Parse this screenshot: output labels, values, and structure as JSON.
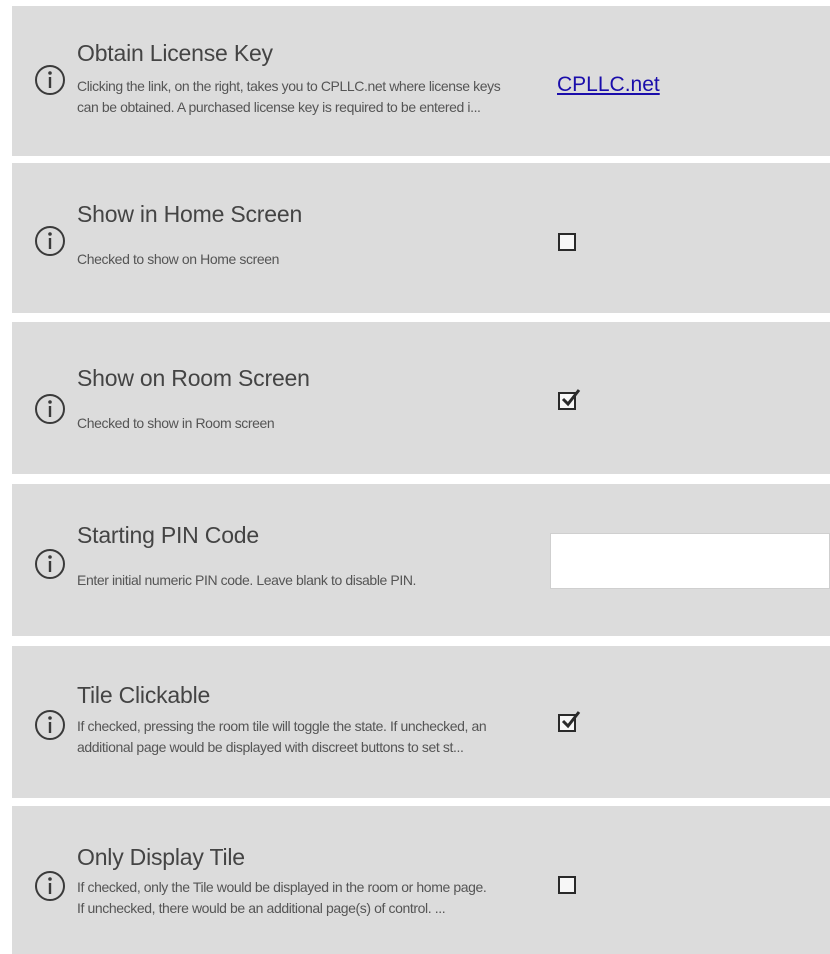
{
  "settings": [
    {
      "title": "Obtain License Key",
      "description_lines": [
        "Clicking the link, on the right, takes you to CPLLC.net where license keys",
        "can be obtained.  A purchased license key is required to be entered i..."
      ],
      "control": "link",
      "link_text": "CPLLC.net"
    },
    {
      "title": "Show in Home Screen",
      "description_lines": [
        "Checked to show on Home screen"
      ],
      "control": "checkbox",
      "checked": false
    },
    {
      "title": "Show on Room Screen",
      "description_lines": [
        "Checked to show in Room screen"
      ],
      "control": "checkbox",
      "checked": true
    },
    {
      "title": "Starting PIN Code",
      "description_lines": [
        "Enter initial numeric PIN code.  Leave blank to disable PIN."
      ],
      "control": "text-input",
      "value": ""
    },
    {
      "title": "Tile Clickable",
      "description_lines": [
        "If checked, pressing the room tile will toggle the state.  If unchecked, an",
        "additional page would  be displayed with discreet buttons to set st..."
      ],
      "control": "checkbox",
      "checked": true
    },
    {
      "title": "Only Display Tile",
      "description_lines": [
        "If checked, only the Tile would be displayed in the room or home page.",
        "If unchecked, there would be an additional page(s) of control.  ..."
      ],
      "control": "checkbox",
      "checked": false
    }
  ],
  "icon": "info-circle-icon",
  "colors": {
    "row_background": "#dcdcdc",
    "link": "#1a0dab",
    "text": "#444444"
  }
}
